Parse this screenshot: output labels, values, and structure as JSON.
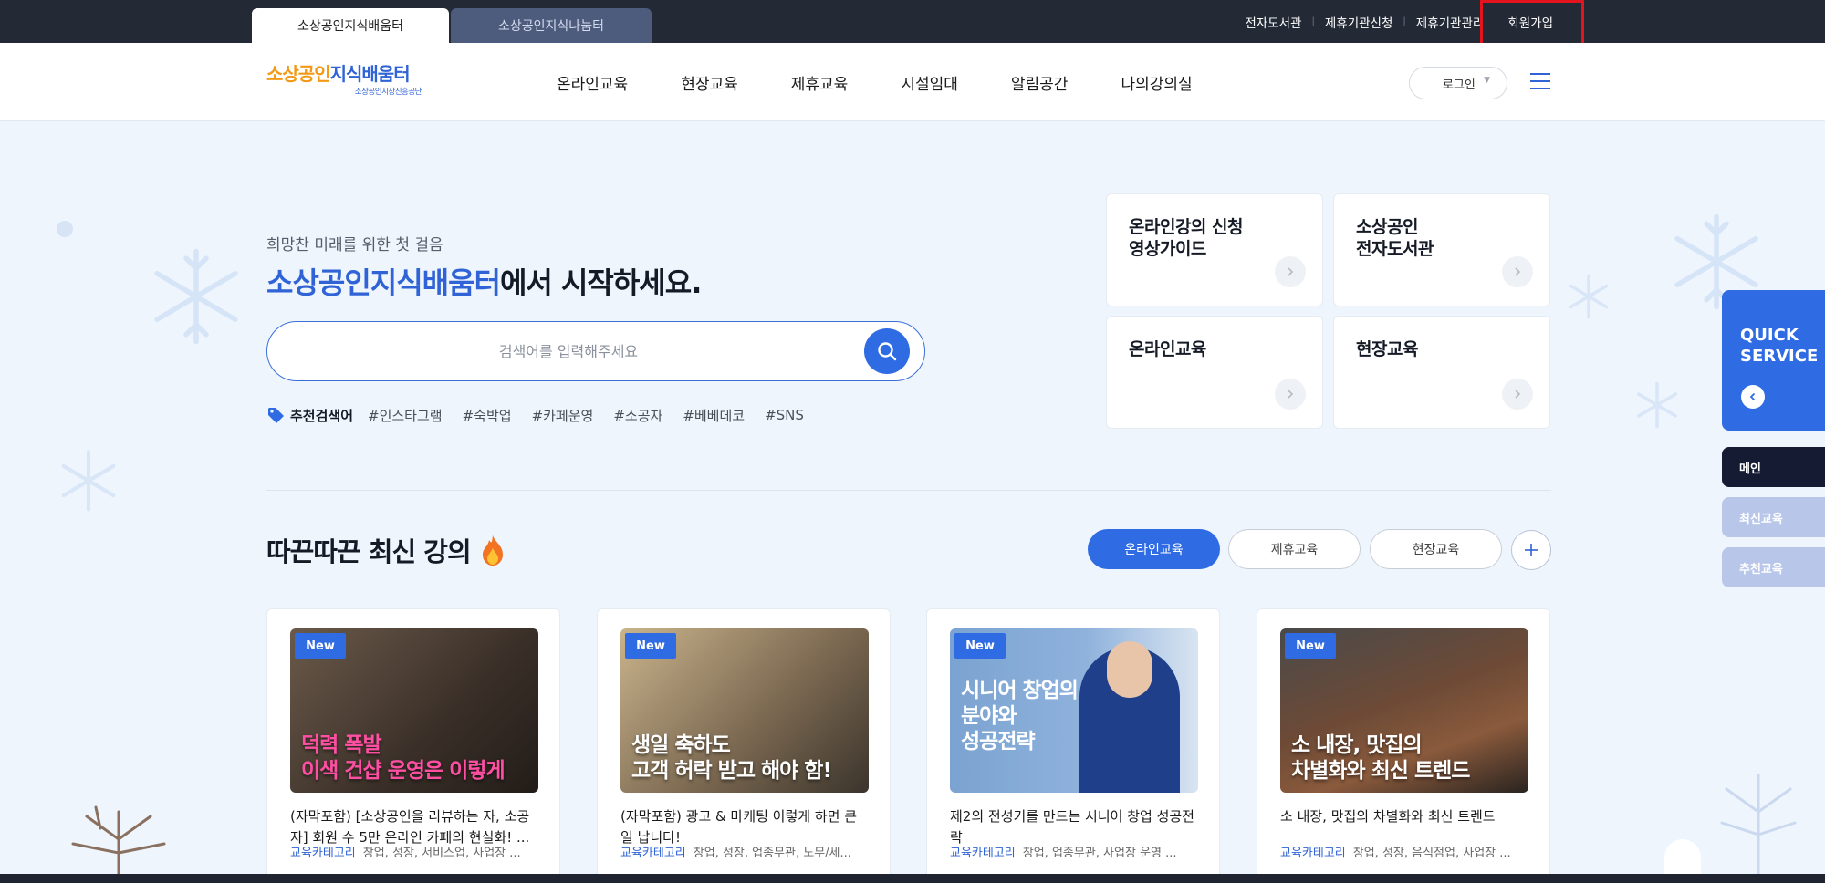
{
  "topbar": {
    "site_tabs": [
      "소상공인지식배움터",
      "소상공인지식나눔터"
    ],
    "links": [
      "전자도서관",
      "제휴기관신청",
      "제휴기관관리",
      "회원가입"
    ]
  },
  "header": {
    "logo_main_orange": "소상공인",
    "logo_main_blue": "지식배움터",
    "logo_sub": "소상공인시장진흥공단",
    "nav": [
      "온라인교육",
      "현장교육",
      "제휴교육",
      "시설임대",
      "알림공간",
      "나의강의실"
    ],
    "login_label": "로그인"
  },
  "hero": {
    "subtitle": "희망찬 미래를 위한 첫 걸음",
    "title_accent": "소상공인지식배움터",
    "title_rest": "에서 시작하세요.",
    "search_placeholder": "검색어를 입력해주세요",
    "tags_label": "추천검색어",
    "tags": [
      "#인스타그램",
      "#숙박업",
      "#카페운영",
      "#소공자",
      "#베베데코",
      "#SNS"
    ]
  },
  "quick_cards": [
    "온라인강의 신청\n영상가이드",
    "소상공인\n전자도서관",
    "온라인교육",
    "현장교육"
  ],
  "courses_section": {
    "title": "따끈따끈 최신 강의",
    "filters": [
      "온라인교육",
      "제휴교육",
      "현장교육"
    ],
    "active_filter": "온라인교육"
  },
  "courses": [
    {
      "badge": "New",
      "thumb_text": "덕력 폭발\n이색 건샵 운영은 이렇게",
      "title": "(자막포함) [소상공인을 리뷰하는 자, 소공자] 회원 수 5만 온라인 카페의 현실화! ...",
      "cat_label": "교육카테고리",
      "cat_value": "창업, 성장, 서비스업, 사업장 ..."
    },
    {
      "badge": "New",
      "thumb_text": "생일 축하도\n고객 허락 받고 해야 함!",
      "title": "(자막포함) 광고 & 마케팅 이렇게 하면 큰일 납니다!",
      "cat_label": "교육카테고리",
      "cat_value": "창업, 성장, 업종무관, 노무/세..."
    },
    {
      "badge": "New",
      "thumb_text": "시니어 창업의\n분야와\n성공전략",
      "title": "제2의 전성기를 만드는 시니어 창업 성공전략",
      "cat_label": "교육카테고리",
      "cat_value": "창업, 업종무관, 사업장 운영 ..."
    },
    {
      "badge": "New",
      "thumb_text": "소 내장, 맛집의\n차별화와 최신 트렌드",
      "title": "소 내장, 맛집의 차별화와 최신 트렌드",
      "cat_label": "교육카테고리",
      "cat_value": "창업, 성장, 음식점업, 사업장 ..."
    }
  ],
  "quick_service": {
    "title": "QUICK\nSERVICE",
    "buttons": [
      "메인",
      "최신교육",
      "추천교육"
    ]
  },
  "colors": {
    "primary": "#2f6be3",
    "topbar": "#232a36",
    "page_bg": "#eef5fd",
    "highlight": "#e3141d"
  },
  "icons": [
    "search-icon",
    "tag-icon",
    "chevron-right-icon",
    "plus-icon",
    "menu-icon",
    "chevron-left-icon",
    "fire-icon"
  ]
}
